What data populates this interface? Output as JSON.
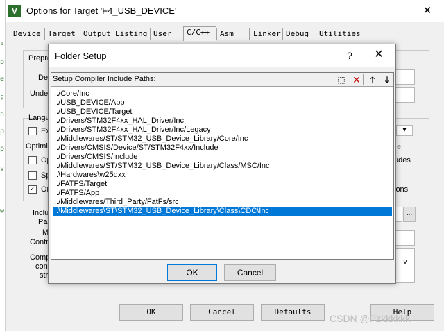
{
  "window": {
    "title": "Options for Target 'F4_USB_DEVICE'",
    "close_glyph": "✕",
    "icon_letter": "V"
  },
  "tabs": [
    {
      "label": "Device",
      "active": false
    },
    {
      "label": "Target",
      "active": false
    },
    {
      "label": "Output",
      "active": false
    },
    {
      "label": "Listing",
      "active": false
    },
    {
      "label": "User",
      "active": false
    },
    {
      "label": "C/C++",
      "active": true
    },
    {
      "label": "Asm",
      "active": false
    },
    {
      "label": "Linker",
      "active": false
    },
    {
      "label": "Debug",
      "active": false
    },
    {
      "label": "Utilities",
      "active": false
    }
  ],
  "background_panel": {
    "preprocessor_label": "Prepro",
    "define_label": "Def",
    "undefine_label": "Unde",
    "language_label": "Langu",
    "optimization_label": "Optimiz",
    "opt_ex": "Ex",
    "opt_op": "Op",
    "opt_sp": "Sp",
    "opt_on": "On",
    "right_fragment_e": "e",
    "right_fragment_udes": "udes",
    "right_fragment_ions": "ions",
    "include_label": "Inclu",
    "path_label": "Pa",
    "misc_label": "M",
    "control_label": "Contr",
    "compiler_label": "Comp",
    "compiler_label_2": "cont",
    "compiler_label_3": "str",
    "browse_glyph": "...",
    "scroll_down_glyph": "v",
    "dropdown_glyph": "▾"
  },
  "bottom_buttons": {
    "ok": "OK",
    "cancel": "Cancel",
    "defaults": "Defaults",
    "help": "Help"
  },
  "folder_setup": {
    "title": "Folder Setup",
    "help_glyph": "?",
    "close_glyph": "✕",
    "list_header": "Setup Compiler Include Paths:",
    "toolbar": {
      "new_glyph": "⬚",
      "delete_glyph": "✕",
      "up_glyph": "🡑",
      "down_glyph": "🡓"
    },
    "paths": [
      "../Core/Inc",
      "../USB_DEVICE/App",
      "../USB_DEVICE/Target",
      "../Drivers/STM32F4xx_HAL_Driver/Inc",
      "../Drivers/STM32F4xx_HAL_Driver/Inc/Legacy",
      "../Middlewares/ST/STM32_USB_Device_Library/Core/Inc",
      "../Drivers/CMSIS/Device/ST/STM32F4xx/Include",
      "../Drivers/CMSIS/Include",
      "../Middlewares/ST/STM32_USB_Device_Library/Class/MSC/Inc",
      "..\\Hardwares\\w25qxx",
      "../FATFS/Target",
      "../FATFS/App",
      "../Middlewares/Third_Party/FatFs/src",
      "..\\Middlewares\\ST\\STM32_USB_Device_Library\\Class\\CDC\\Inc"
    ],
    "selected_index": 13,
    "ok_label": "OK",
    "cancel_label": "Cancel"
  },
  "left_strip_marks": [
    "s",
    "p",
    "e",
    ";",
    "n",
    "p",
    "p",
    "x",
    "w"
  ],
  "watermark": "CSDN @Pzkkkkkk"
}
